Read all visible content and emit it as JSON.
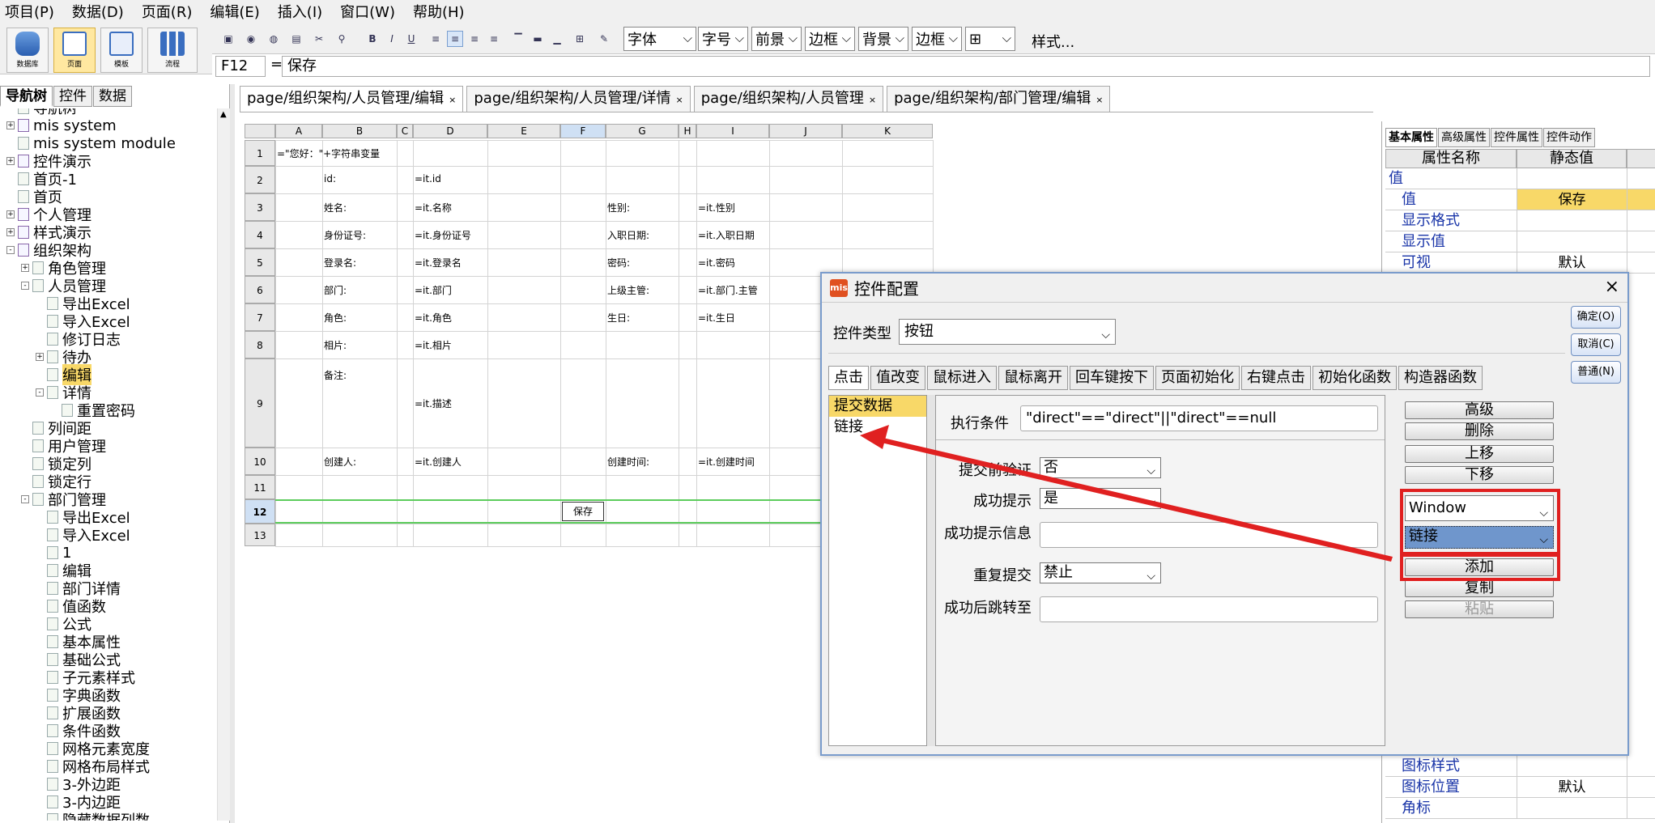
{
  "menu": [
    "项目(P)",
    "数据(D)",
    "页面(R)",
    "编辑(E)",
    "插入(I)",
    "窗口(W)",
    "帮助(H)"
  ],
  "toolbar": {
    "big_buttons": [
      "数据库",
      "页面",
      "模板",
      "流程"
    ],
    "selects": [
      "字体",
      "字号",
      "前景",
      "边框",
      "背景",
      "边框"
    ],
    "style_label": "样式..."
  },
  "formula_bar": {
    "cell_ref": "F12",
    "equals": "=",
    "value": "保存"
  },
  "left_panel": {
    "tabs": [
      "导航树",
      "控件",
      "数据"
    ],
    "tree": [
      {
        "label": "导航树",
        "level": 0,
        "exp": ""
      },
      {
        "label": "mis system",
        "level": 0,
        "exp": "+"
      },
      {
        "label": "mis system module",
        "level": 0,
        "exp": ""
      },
      {
        "label": "控件演示",
        "level": 0,
        "exp": "+"
      },
      {
        "label": "首页-1",
        "level": 0,
        "exp": ""
      },
      {
        "label": "首页",
        "level": 0,
        "exp": ""
      },
      {
        "label": "个人管理",
        "level": 0,
        "exp": "+"
      },
      {
        "label": "样式演示",
        "level": 0,
        "exp": "+"
      },
      {
        "label": "组织架构",
        "level": 0,
        "exp": "-"
      },
      {
        "label": "角色管理",
        "level": 1,
        "exp": "+"
      },
      {
        "label": "人员管理",
        "level": 1,
        "exp": "-"
      },
      {
        "label": "导出Excel",
        "level": 2,
        "exp": ""
      },
      {
        "label": "导入Excel",
        "level": 2,
        "exp": ""
      },
      {
        "label": "修订日志",
        "level": 2,
        "exp": ""
      },
      {
        "label": "待办",
        "level": 2,
        "exp": "+"
      },
      {
        "label": "编辑",
        "level": 2,
        "exp": "",
        "selected": true
      },
      {
        "label": "详情",
        "level": 2,
        "exp": "-"
      },
      {
        "label": "重置密码",
        "level": 3,
        "exp": ""
      },
      {
        "label": "列间距",
        "level": 1,
        "exp": ""
      },
      {
        "label": "用户管理",
        "level": 1,
        "exp": ""
      },
      {
        "label": "锁定列",
        "level": 1,
        "exp": ""
      },
      {
        "label": "锁定行",
        "level": 1,
        "exp": ""
      },
      {
        "label": "部门管理",
        "level": 1,
        "exp": "-"
      },
      {
        "label": "导出Excel",
        "level": 2,
        "exp": ""
      },
      {
        "label": "导入Excel",
        "level": 2,
        "exp": ""
      },
      {
        "label": "1",
        "level": 2,
        "exp": ""
      },
      {
        "label": "编辑",
        "level": 2,
        "exp": ""
      },
      {
        "label": "部门详情",
        "level": 2,
        "exp": ""
      },
      {
        "label": "值函数",
        "level": 2,
        "exp": ""
      },
      {
        "label": "公式",
        "level": 2,
        "exp": ""
      },
      {
        "label": "基本属性",
        "level": 2,
        "exp": ""
      },
      {
        "label": "基础公式",
        "level": 2,
        "exp": ""
      },
      {
        "label": "子元素样式",
        "level": 2,
        "exp": ""
      },
      {
        "label": "字典函数",
        "level": 2,
        "exp": ""
      },
      {
        "label": "扩展函数",
        "level": 2,
        "exp": ""
      },
      {
        "label": "条件函数",
        "level": 2,
        "exp": ""
      },
      {
        "label": "网格元素宽度",
        "level": 2,
        "exp": ""
      },
      {
        "label": "网格布局样式",
        "level": 2,
        "exp": ""
      },
      {
        "label": "3-外边距",
        "level": 2,
        "exp": ""
      },
      {
        "label": "3-内边距",
        "level": 2,
        "exp": ""
      },
      {
        "label": "隐藏数据列数",
        "level": 2,
        "exp": ""
      }
    ]
  },
  "doc_tabs": [
    "page/组织架构/人员管理/编辑",
    "page/组织架构/人员管理/详情",
    "page/组织架构/人员管理",
    "page/组织架构/部门管理/编辑"
  ],
  "doc_tab_close": "×",
  "sheet": {
    "columns": [
      "A",
      "B",
      "C",
      "D",
      "E",
      "F",
      "G",
      "H",
      "I",
      "J",
      "K"
    ],
    "rows": [
      "1",
      "2",
      "3",
      "4",
      "5",
      "6",
      "7",
      "8",
      "9",
      "10",
      "11",
      "12",
      "13"
    ],
    "cells": [
      {
        "row": 1,
        "col": "A",
        "text": "=\"您好：\"+字符串变量"
      },
      {
        "row": 2,
        "col": "B",
        "text": "id:"
      },
      {
        "row": 2,
        "col": "D",
        "text": "=it.id"
      },
      {
        "row": 3,
        "col": "B",
        "text": "姓名:"
      },
      {
        "row": 3,
        "col": "D",
        "text": "=it.名称"
      },
      {
        "row": 3,
        "col": "G",
        "text": "性别:"
      },
      {
        "row": 3,
        "col": "I",
        "text": "=it.性别"
      },
      {
        "row": 4,
        "col": "B",
        "text": "身份证号:"
      },
      {
        "row": 4,
        "col": "D",
        "text": "=it.身份证号"
      },
      {
        "row": 4,
        "col": "G",
        "text": "入职日期:"
      },
      {
        "row": 4,
        "col": "I",
        "text": "=it.入职日期"
      },
      {
        "row": 5,
        "col": "B",
        "text": "登录名:"
      },
      {
        "row": 5,
        "col": "D",
        "text": "=it.登录名"
      },
      {
        "row": 5,
        "col": "G",
        "text": "密码:"
      },
      {
        "row": 5,
        "col": "I",
        "text": "=it.密码"
      },
      {
        "row": 6,
        "col": "B",
        "text": "部门:"
      },
      {
        "row": 6,
        "col": "D",
        "text": "=it.部门"
      },
      {
        "row": 6,
        "col": "G",
        "text": "上级主管:"
      },
      {
        "row": 6,
        "col": "I",
        "text": "=it.部门.主管"
      },
      {
        "row": 7,
        "col": "B",
        "text": "角色:"
      },
      {
        "row": 7,
        "col": "D",
        "text": "=it.角色"
      },
      {
        "row": 7,
        "col": "G",
        "text": "生日:"
      },
      {
        "row": 7,
        "col": "I",
        "text": "=it.生日"
      },
      {
        "row": 8,
        "col": "B",
        "text": "相片:"
      },
      {
        "row": 8,
        "col": "D",
        "text": "=it.相片"
      },
      {
        "row": 9,
        "col": "B",
        "text": "备注:"
      },
      {
        "row": 9,
        "col": "D",
        "text": "=it.描述"
      },
      {
        "row": 10,
        "col": "B",
        "text": "创建人:"
      },
      {
        "row": 10,
        "col": "D",
        "text": "=it.创建人"
      },
      {
        "row": 10,
        "col": "G",
        "text": "创建时间:"
      },
      {
        "row": 10,
        "col": "I",
        "text": "=it.创建时间"
      },
      {
        "row": 12,
        "col": "F",
        "text": "保存",
        "button": true
      }
    ]
  },
  "right_panel": {
    "tabs": [
      "基本属性",
      "高级属性",
      "控件属性",
      "控件动作"
    ],
    "headers": [
      "属性名称",
      "静态值"
    ],
    "rows_top": [
      {
        "name": "值",
        "value": "",
        "group": true
      },
      {
        "name": "值",
        "value": "保存",
        "highlight": true
      },
      {
        "name": "显示格式",
        "value": ""
      },
      {
        "name": "显示值",
        "value": ""
      },
      {
        "name": "可视",
        "value": "默认"
      }
    ],
    "rows_bottom": [
      {
        "name": "图标样式",
        "value": ""
      },
      {
        "name": "图标位置",
        "value": "默认"
      },
      {
        "name": "角标",
        "value": ""
      }
    ]
  },
  "dialog": {
    "title": "控件配置",
    "close": "×",
    "control_type_label": "控件类型",
    "control_type_value": "按钮",
    "buttons": {
      "ok": "确定(O)",
      "cancel": "取消(C)",
      "normal": "普通(N)"
    },
    "event_tabs": [
      "点击",
      "值改变",
      "鼠标进入",
      "鼠标离开",
      "回车键按下",
      "页面初始化",
      "右键点击",
      "初始化函数",
      "构造器函数"
    ],
    "actions": [
      "提交数据",
      "链接"
    ],
    "form": {
      "condition_label": "执行条件",
      "condition_value": "\"direct\"==\"direct\"||\"direct\"==null",
      "validate_label": "提交前验证",
      "validate_value": "否",
      "success_tip_label": "成功提示",
      "success_tip_value": "是",
      "success_msg_label": "成功提示信息",
      "success_msg_value": "",
      "repeat_label": "重复提交",
      "repeat_value": "禁止",
      "redirect_label": "成功后跳转至",
      "redirect_value": ""
    },
    "right_buttons": [
      "高级",
      "删除",
      "上移",
      "下移"
    ],
    "window_select": "Window",
    "link_select": "链接",
    "add_button": "添加",
    "copy_button": "复制",
    "paste_button": "粘贴"
  },
  "colors": {
    "selected": "#f8d868",
    "annotation": "#e02020",
    "accent_blue": "#1a35a8"
  }
}
